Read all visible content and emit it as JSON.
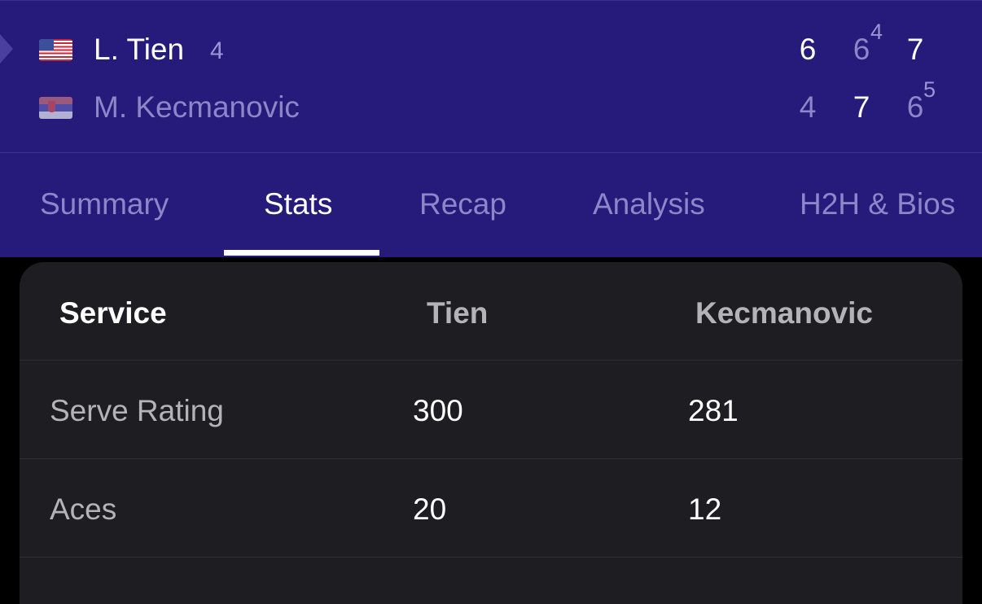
{
  "match": {
    "players": [
      {
        "name": "L. Tien",
        "seed": "4",
        "flag": "usa-flag",
        "sets": [
          "6",
          "6",
          "7"
        ],
        "tiebreaks": [
          "",
          "4",
          ""
        ]
      },
      {
        "name": "M. Kecmanovic",
        "seed": "",
        "flag": "serbia-flag",
        "sets": [
          "4",
          "7",
          "6"
        ],
        "tiebreaks": [
          "",
          "",
          "5"
        ]
      }
    ]
  },
  "tabs": [
    {
      "label": "Summary",
      "active": false
    },
    {
      "label": "Stats",
      "active": true
    },
    {
      "label": "Recap",
      "active": false
    },
    {
      "label": "Analysis",
      "active": false
    },
    {
      "label": "H2H & Bios",
      "active": false
    }
  ],
  "stats": {
    "section_title": "Service",
    "player1_short": "Tien",
    "player2_short": "Kecmanovic",
    "rows": [
      {
        "label": "Serve Rating",
        "p1": "300",
        "p2": "281"
      },
      {
        "label": "Aces",
        "p1": "20",
        "p2": "12"
      }
    ]
  },
  "colors": {
    "header_bg": "#261a7a",
    "card_bg": "#1e1e22",
    "winner_text": "#ffffff",
    "muted_text": "#8d86c9"
  }
}
